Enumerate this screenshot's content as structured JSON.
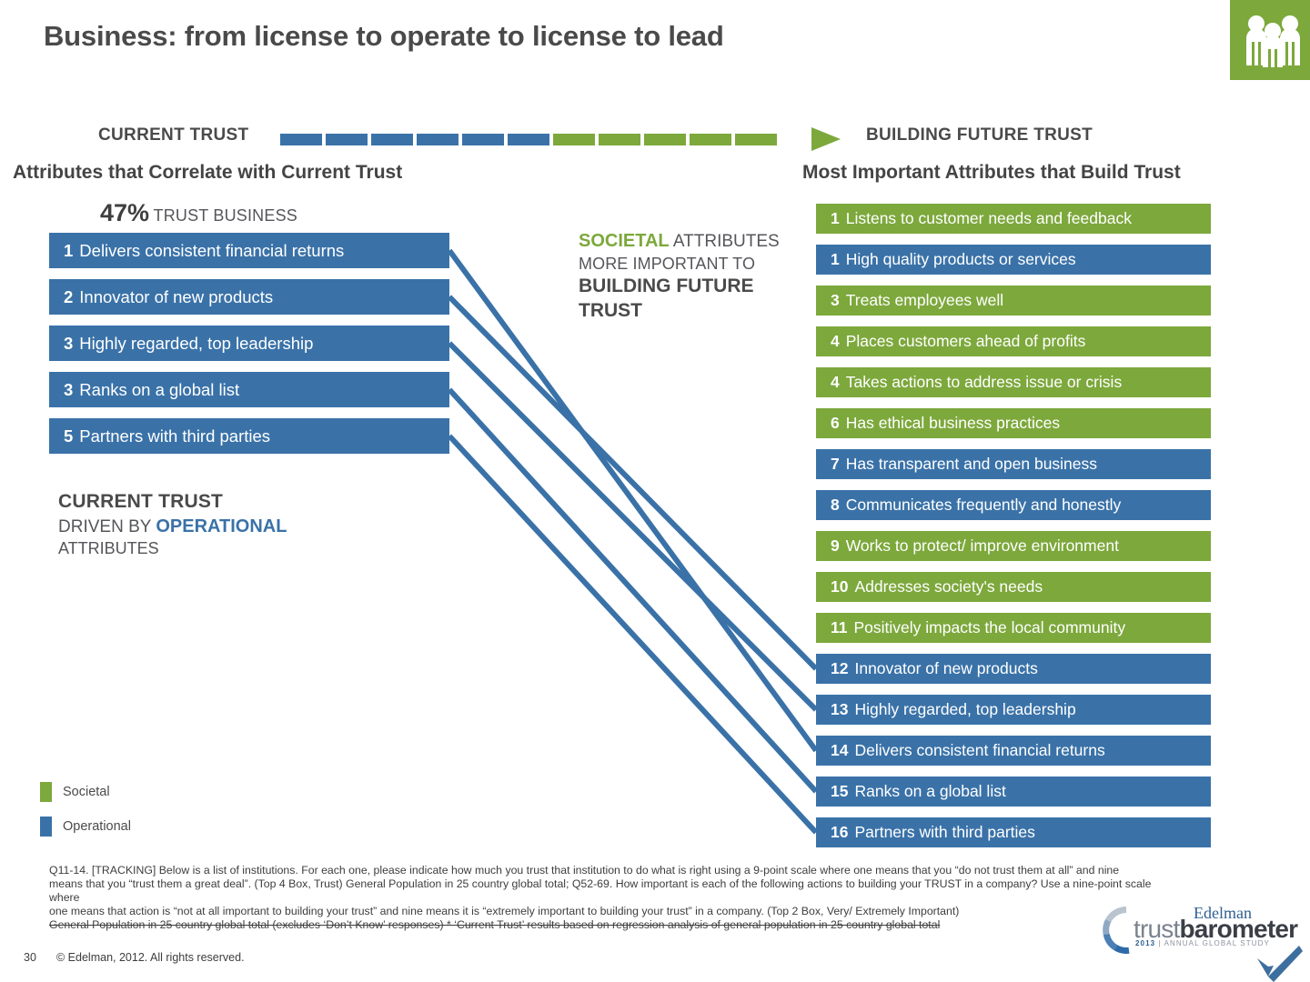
{
  "title": "Business: from license to operate to license to lead",
  "colors": {
    "societal_green": "#7DA83C",
    "operational_blue": "#3A72A8",
    "text_dark": "#4a4a4a"
  },
  "arrow": {
    "left_label": "CURRENT TRUST",
    "right_label": "BUILDING FUTURE TRUST",
    "blue_dashes": 6,
    "green_dashes": 5
  },
  "left": {
    "heading": "Attributes that Correlate with Current Trust",
    "stat_value": "47%",
    "stat_label": "TRUST BUSINESS",
    "items": [
      {
        "rank": "1",
        "label": "Delivers consistent financial returns",
        "type": "operational"
      },
      {
        "rank": "2",
        "label": "Innovator of new products",
        "type": "operational"
      },
      {
        "rank": "3",
        "label": "Highly regarded, top leadership",
        "type": "operational"
      },
      {
        "rank": "3",
        "label": "Ranks on a global list",
        "type": "operational"
      },
      {
        "rank": "5",
        "label": "Partners with third parties",
        "type": "operational"
      }
    ],
    "note_line1": "CURRENT TRUST",
    "note_line2_pre": "DRIVEN BY ",
    "note_line2_em": "OPERATIONAL",
    "note_line3": "ATTRIBUTES"
  },
  "middle": {
    "note_em": "SOCIETAL",
    "note_rest": " ATTRIBUTES",
    "note_line2": "MORE IMPORTANT TO",
    "note_line3": "BUILDING FUTURE",
    "note_line4": "TRUST"
  },
  "right": {
    "heading": "Most Important Attributes that Build Trust",
    "items": [
      {
        "rank": "1",
        "label": "Listens to customer needs and feedback",
        "type": "societal"
      },
      {
        "rank": "1",
        "label": "High quality products or services",
        "type": "operational"
      },
      {
        "rank": "3",
        "label": "Treats employees well",
        "type": "societal"
      },
      {
        "rank": "4",
        "label": "Places customers ahead of profits",
        "type": "societal"
      },
      {
        "rank": "4",
        "label": "Takes actions to address issue or crisis",
        "type": "societal"
      },
      {
        "rank": "6",
        "label": "Has ethical business practices",
        "type": "societal"
      },
      {
        "rank": "7",
        "label": "Has transparent and open business",
        "type": "operational"
      },
      {
        "rank": "8",
        "label": "Communicates frequently and honestly",
        "type": "operational"
      },
      {
        "rank": "9",
        "label": "Works to protect/ improve environment",
        "type": "societal"
      },
      {
        "rank": "10",
        "label": "Addresses society's needs",
        "type": "societal"
      },
      {
        "rank": "11",
        "label": "Positively impacts the local community",
        "type": "societal"
      },
      {
        "rank": "12",
        "label": "Innovator of new products",
        "type": "operational"
      },
      {
        "rank": "13",
        "label": " Highly regarded, top leadership",
        "type": "operational"
      },
      {
        "rank": "14",
        "label": "Delivers consistent financial returns",
        "type": "operational"
      },
      {
        "rank": "15",
        "label": "Ranks on a global list",
        "type": "operational"
      },
      {
        "rank": "16",
        "label": "Partners with third parties",
        "type": "operational"
      }
    ]
  },
  "legend": [
    {
      "label": "Societal",
      "color": "#7DA83C"
    },
    {
      "label": "Operational",
      "color": "#3A72A8"
    }
  ],
  "footnote": {
    "line1": "Q11-14. [TRACKING] Below is a list of institutions. For each one, please indicate how much you trust that institution to do what is right using a 9-point scale where one means that you “do not trust them at all” and nine",
    "line2": "means that you “trust them a great deal”. (Top 4 Box, Trust) General Population in 25 country global total; Q52-69. How important is each of the following actions to building your TRUST in a company? Use a nine-point scale",
    "line3": "where",
    "line4": "one means that action is “not at all important to building your trust” and nine means it is “extremely important to building your trust” in a company. (Top 2 Box, Very/ Extremely Important)",
    "line5": "General Population in 25 country global total (excludes ‘Don’t Know’ responses) * ‘Current Trust’ results based on regression analysis of general population in 25 country global total"
  },
  "footer": {
    "page_number": "30",
    "copyright": "© Edelman, 2012. All rights reserved."
  },
  "logo": {
    "edelman": "Edelman",
    "word_light": "trust",
    "word_bold": "barometer",
    "sub_year": "2013",
    "sub_rest": " | ANNUAL GLOBAL STUDY"
  },
  "connectors": [
    {
      "from": 0,
      "to": 13
    },
    {
      "from": 1,
      "to": 11
    },
    {
      "from": 2,
      "to": 12
    },
    {
      "from": 3,
      "to": 14
    },
    {
      "from": 4,
      "to": 15
    }
  ]
}
